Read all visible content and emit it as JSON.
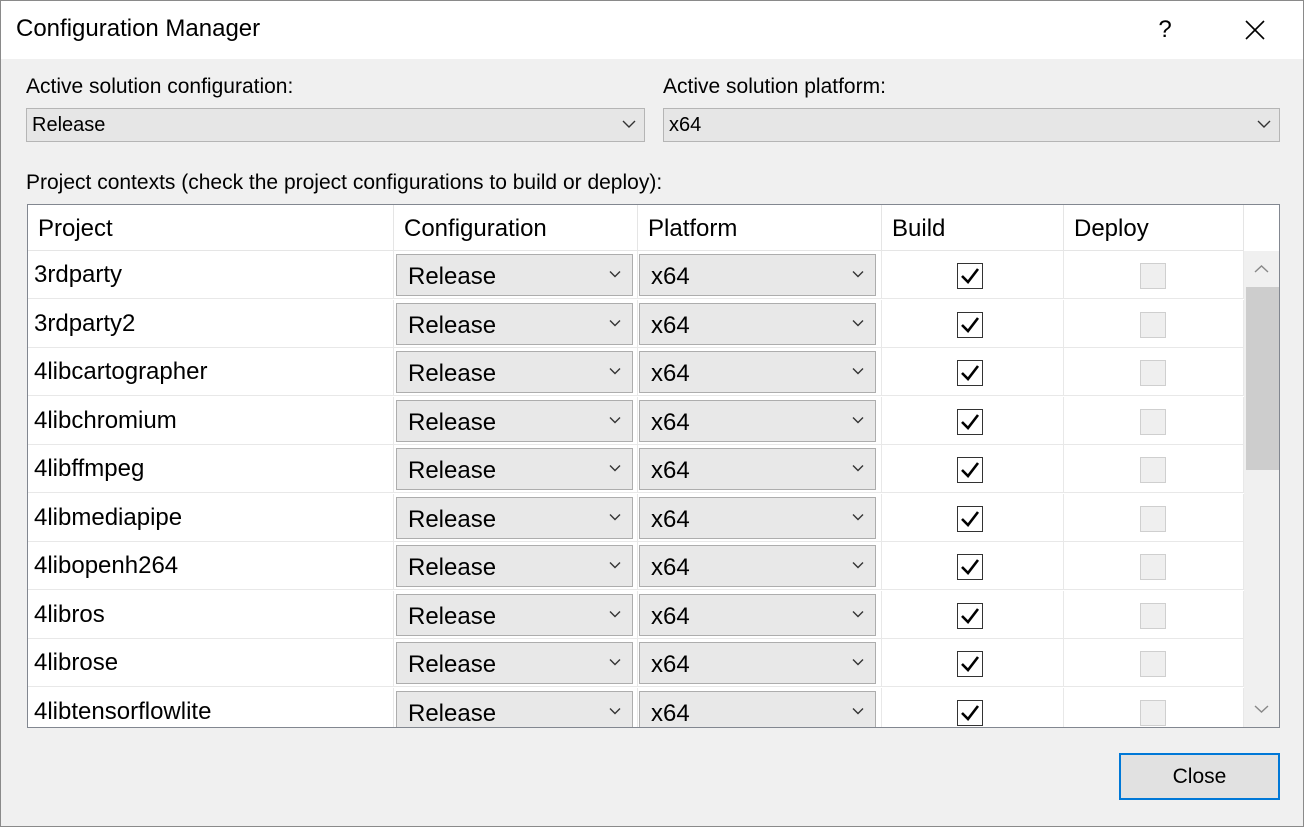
{
  "dialog": {
    "title": "Configuration Manager",
    "help_label": "?"
  },
  "active_configuration": {
    "label": "Active solution configuration:",
    "value": "Release"
  },
  "active_platform": {
    "label": "Active solution platform:",
    "value": "x64"
  },
  "project_contexts_label": "Project contexts (check the project configurations to build or deploy):",
  "columns": [
    "Project",
    "Configuration",
    "Platform",
    "Build",
    "Deploy"
  ],
  "rows": [
    {
      "project": "3rdparty",
      "configuration": "Release",
      "platform": "x64",
      "build": true,
      "deploy": false
    },
    {
      "project": "3rdparty2",
      "configuration": "Release",
      "platform": "x64",
      "build": true,
      "deploy": false
    },
    {
      "project": "4libcartographer",
      "configuration": "Release",
      "platform": "x64",
      "build": true,
      "deploy": false
    },
    {
      "project": "4libchromium",
      "configuration": "Release",
      "platform": "x64",
      "build": true,
      "deploy": false
    },
    {
      "project": "4libffmpeg",
      "configuration": "Release",
      "platform": "x64",
      "build": true,
      "deploy": false
    },
    {
      "project": "4libmediapipe",
      "configuration": "Release",
      "platform": "x64",
      "build": true,
      "deploy": false
    },
    {
      "project": "4libopenh264",
      "configuration": "Release",
      "platform": "x64",
      "build": true,
      "deploy": false
    },
    {
      "project": "4libros",
      "configuration": "Release",
      "platform": "x64",
      "build": true,
      "deploy": false
    },
    {
      "project": "4librose",
      "configuration": "Release",
      "platform": "x64",
      "build": true,
      "deploy": false
    },
    {
      "project": "4libtensorflowlite",
      "configuration": "Release",
      "platform": "x64",
      "build": true,
      "deploy": false
    }
  ],
  "close_button": {
    "label": "Close"
  },
  "colors": {
    "accent": "#0078d7",
    "title_bar": "#ffffff",
    "dialog_bg": "#f0f0f0"
  }
}
